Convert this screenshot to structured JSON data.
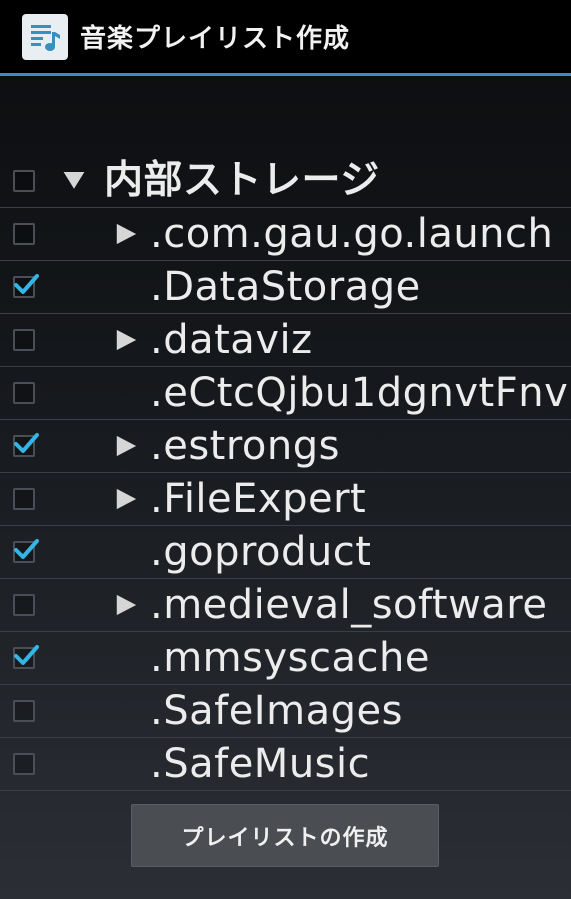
{
  "app": {
    "title": "音楽プレイリスト作成",
    "icon": "music-playlist-icon",
    "accent_color": "#3a8fbf"
  },
  "tree": {
    "root": {
      "label": "内部ストレージ",
      "expanded": true,
      "checked": false
    },
    "items": [
      {
        "label": ".com.gau.go.launch",
        "has_children": true,
        "checked": false
      },
      {
        "label": ".DataStorage",
        "has_children": false,
        "checked": true
      },
      {
        "label": ".dataviz",
        "has_children": true,
        "checked": false
      },
      {
        "label": ".eCtcQjbu1dgnvtFnv",
        "has_children": false,
        "checked": false
      },
      {
        "label": ".estrongs",
        "has_children": true,
        "checked": true
      },
      {
        "label": ".FileExpert",
        "has_children": true,
        "checked": false
      },
      {
        "label": ".goproduct",
        "has_children": false,
        "checked": true
      },
      {
        "label": ".medieval_software",
        "has_children": true,
        "checked": false
      },
      {
        "label": ".mmsyscache",
        "has_children": false,
        "checked": true
      },
      {
        "label": ".SafeImages",
        "has_children": false,
        "checked": false
      },
      {
        "label": ".SafeMusic",
        "has_children": false,
        "checked": false
      }
    ]
  },
  "actions": {
    "create_label": "プレイリストの作成"
  }
}
